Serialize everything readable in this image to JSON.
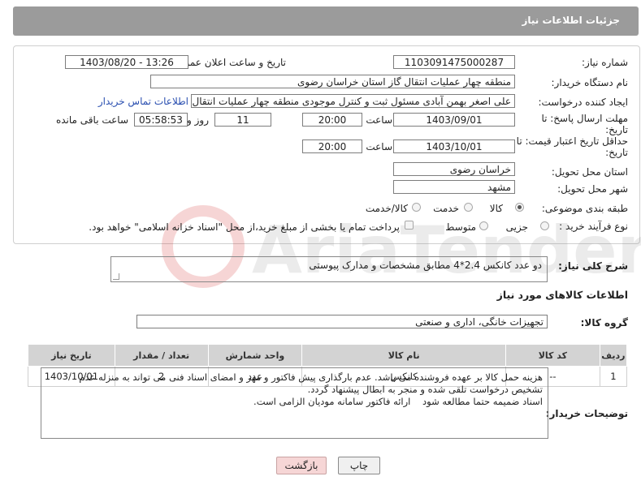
{
  "header": {
    "title": "جزئیات اطلاعات نیاز"
  },
  "form": {
    "need_number_label": "شماره نیاز:",
    "need_number": "1103091475000287",
    "announce_label": "تاریخ و ساعت اعلان عمومی:",
    "announce_value": "1403/08/20 - 13:26",
    "buyer_label": "نام دستگاه خریدار:",
    "buyer_value": "منطقه چهار عملیات انتقال گاز    استان خراسان رضوی",
    "creator_label": "ایجاد کننده درخواست:",
    "creator_value": "علی اصغر بهمن آبادی مسئول ثبت و کنترل موجودی منطقه چهار عملیات انتقال گ",
    "contact_link": "اطلاعات تماس خریدار",
    "deadline_label_1": "مهلت ارسال پاسخ: تا",
    "deadline_label_2": "تاریخ:",
    "deadline_date": "1403/09/01",
    "time_label": "ساعت",
    "deadline_time": "20:00",
    "days_value": "11",
    "days_label": "روز و",
    "remaining_value": "05:58:53",
    "remaining_label": "ساعت باقی مانده",
    "validity_label_1": "حداقل تاریخ اعتبار قیمت: تا",
    "validity_label_2": "تاریخ:",
    "validity_date": "1403/10/01",
    "validity_time_label": "ساعت",
    "validity_time": "20:00",
    "province_label": "استان محل تحویل:",
    "province_value": "خراسان رضوی",
    "city_label": "شهر محل تحویل:",
    "city_value": "مشهد",
    "category_label": "طبقه بندی موضوعی:",
    "category_options": [
      "کالا",
      "خدمت",
      "کالا/خدمت"
    ],
    "category_selected": "کالا",
    "process_label": "نوع فرآیند خرید :",
    "process_options": [
      "جزیی",
      "متوسط"
    ],
    "payment_note": "پرداخت تمام یا بخشی از مبلغ خرید،از محل \"اسناد خزانه اسلامی\" خواهد بود."
  },
  "description": {
    "label": "شرح کلی نیاز:",
    "value": "دو عدد کانکس 2.4*4 مطابق مشخصات و مدارک پیوستی"
  },
  "items_section": {
    "title": "اطلاعات کالاهای مورد نیاز",
    "group_label": "گروه کالا:",
    "group_value": "تجهیزات خانگی، اداری و صنعتی"
  },
  "table": {
    "headers": [
      "ردیف",
      "کد کالا",
      "نام کالا",
      "واحد شمارش",
      "تعداد / مقدار",
      "تاریخ نیاز"
    ],
    "rows": [
      [
        "1",
        "--",
        "کانکس",
        "عدد",
        "2",
        "1403/10/01"
      ]
    ]
  },
  "buyer_notes": {
    "label": "توضیحات خریدار:",
    "text": "هزینه حمل کالا بر عهده فروشنده می باشد. عدم بارگذاری پیش فاکتور و مهر و امضای اسناد فنی می تواند به منزله عدم تشخیص درخواست تلقی شده و منجر به ابطال پیشنهاد گردد.\nاسناد ضمیمه حتما مطالعه شود    ارائه فاکتور سامانه مودیان الزامی است."
  },
  "buttons": {
    "print": "چاپ",
    "back": "بازگشت"
  },
  "watermark": {
    "text": "AriaTender.neT"
  },
  "colors": {
    "header_bg": "#9b9b9b",
    "link": "#2a4fb0",
    "back_button_bg": "#f6d6d6",
    "table_header_bg": "#d3d3d3"
  }
}
